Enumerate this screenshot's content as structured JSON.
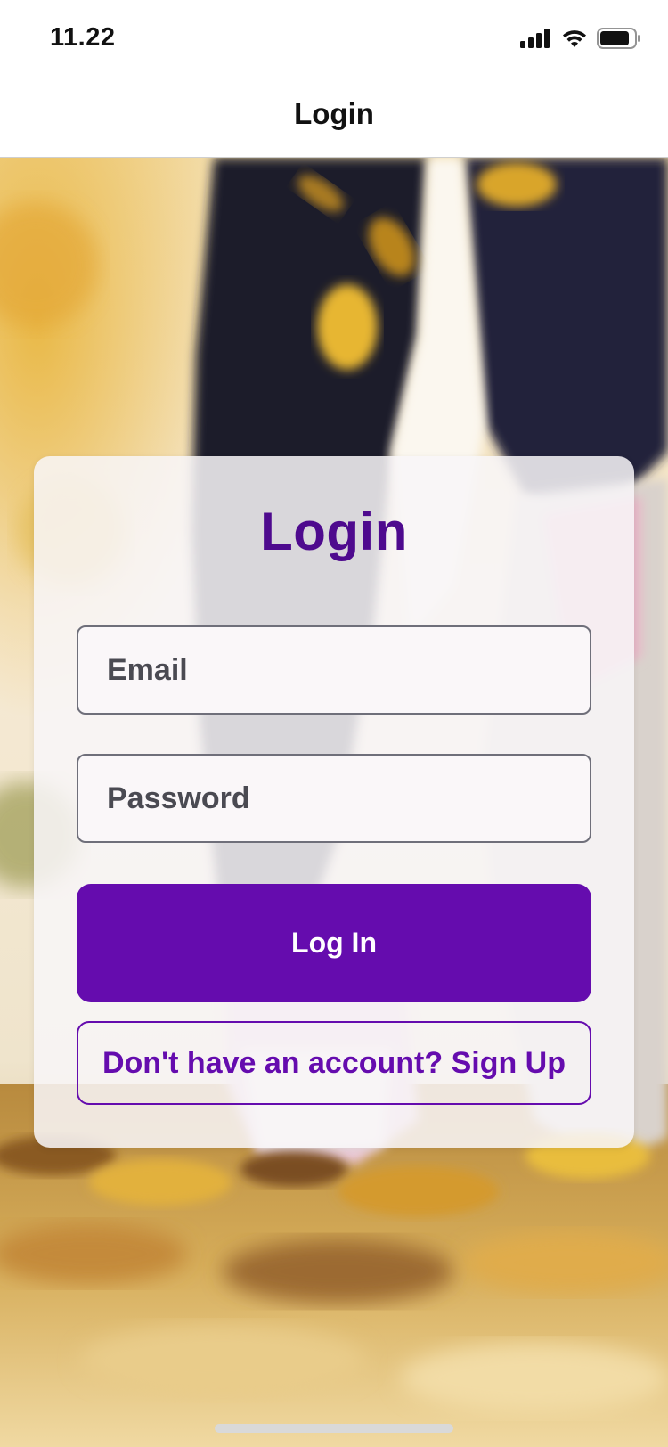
{
  "status_bar": {
    "time": "11.22",
    "icons": [
      "cellular-signal-icon",
      "wifi-icon",
      "battery-icon"
    ]
  },
  "nav": {
    "title": "Login"
  },
  "card": {
    "title": "Login",
    "email_placeholder": "Email",
    "email_value": "",
    "password_placeholder": "Password",
    "password_value": "",
    "login_button_label": "Log In",
    "signup_button_label": "Don't have an account? Sign Up"
  },
  "colors": {
    "accent": "#650cae",
    "title_purple": "#4e0a8e",
    "field_border": "#6f6f7a"
  }
}
